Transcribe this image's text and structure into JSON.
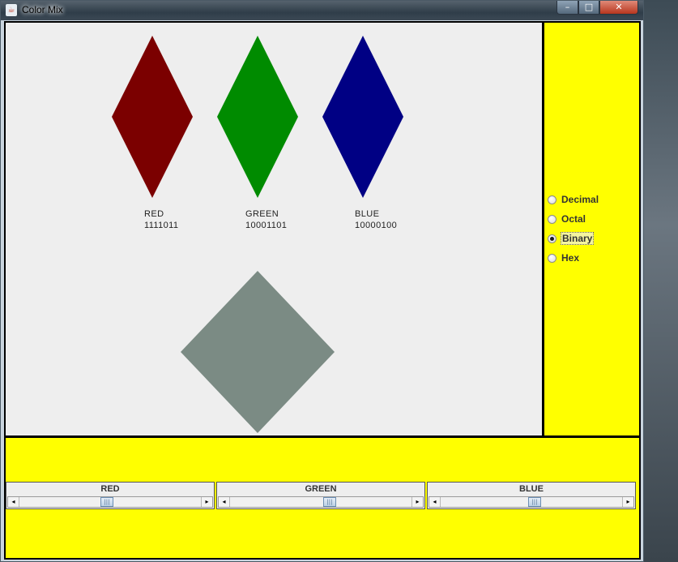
{
  "window": {
    "title": "Color Mix",
    "minimize_glyph": "–",
    "maximize_glyph": "□",
    "close_glyph": "✕"
  },
  "colors": {
    "red_diamond": "#7b0000",
    "green_diamond": "#008b00",
    "blue_diamond": "#000084",
    "mixed_diamond": "#7b8b84",
    "panel_background": "#ffff00"
  },
  "channels": [
    {
      "name": "RED",
      "value": "1111011"
    },
    {
      "name": "GREEN",
      "value": "10001101"
    },
    {
      "name": "BLUE",
      "value": "10000100"
    }
  ],
  "number_format": {
    "options": [
      "Decimal",
      "Octal",
      "Binary",
      "Hex"
    ],
    "selected": "Binary"
  },
  "sliders": [
    {
      "label": "RED",
      "value": 123,
      "max": 255
    },
    {
      "label": "GREEN",
      "value": 141,
      "max": 255
    },
    {
      "label": "BLUE",
      "value": 132,
      "max": 255
    }
  ],
  "icons": {
    "app": "java-cup-icon",
    "left_arrow": "◂",
    "right_arrow": "▸",
    "thumb_grip": "|||"
  }
}
